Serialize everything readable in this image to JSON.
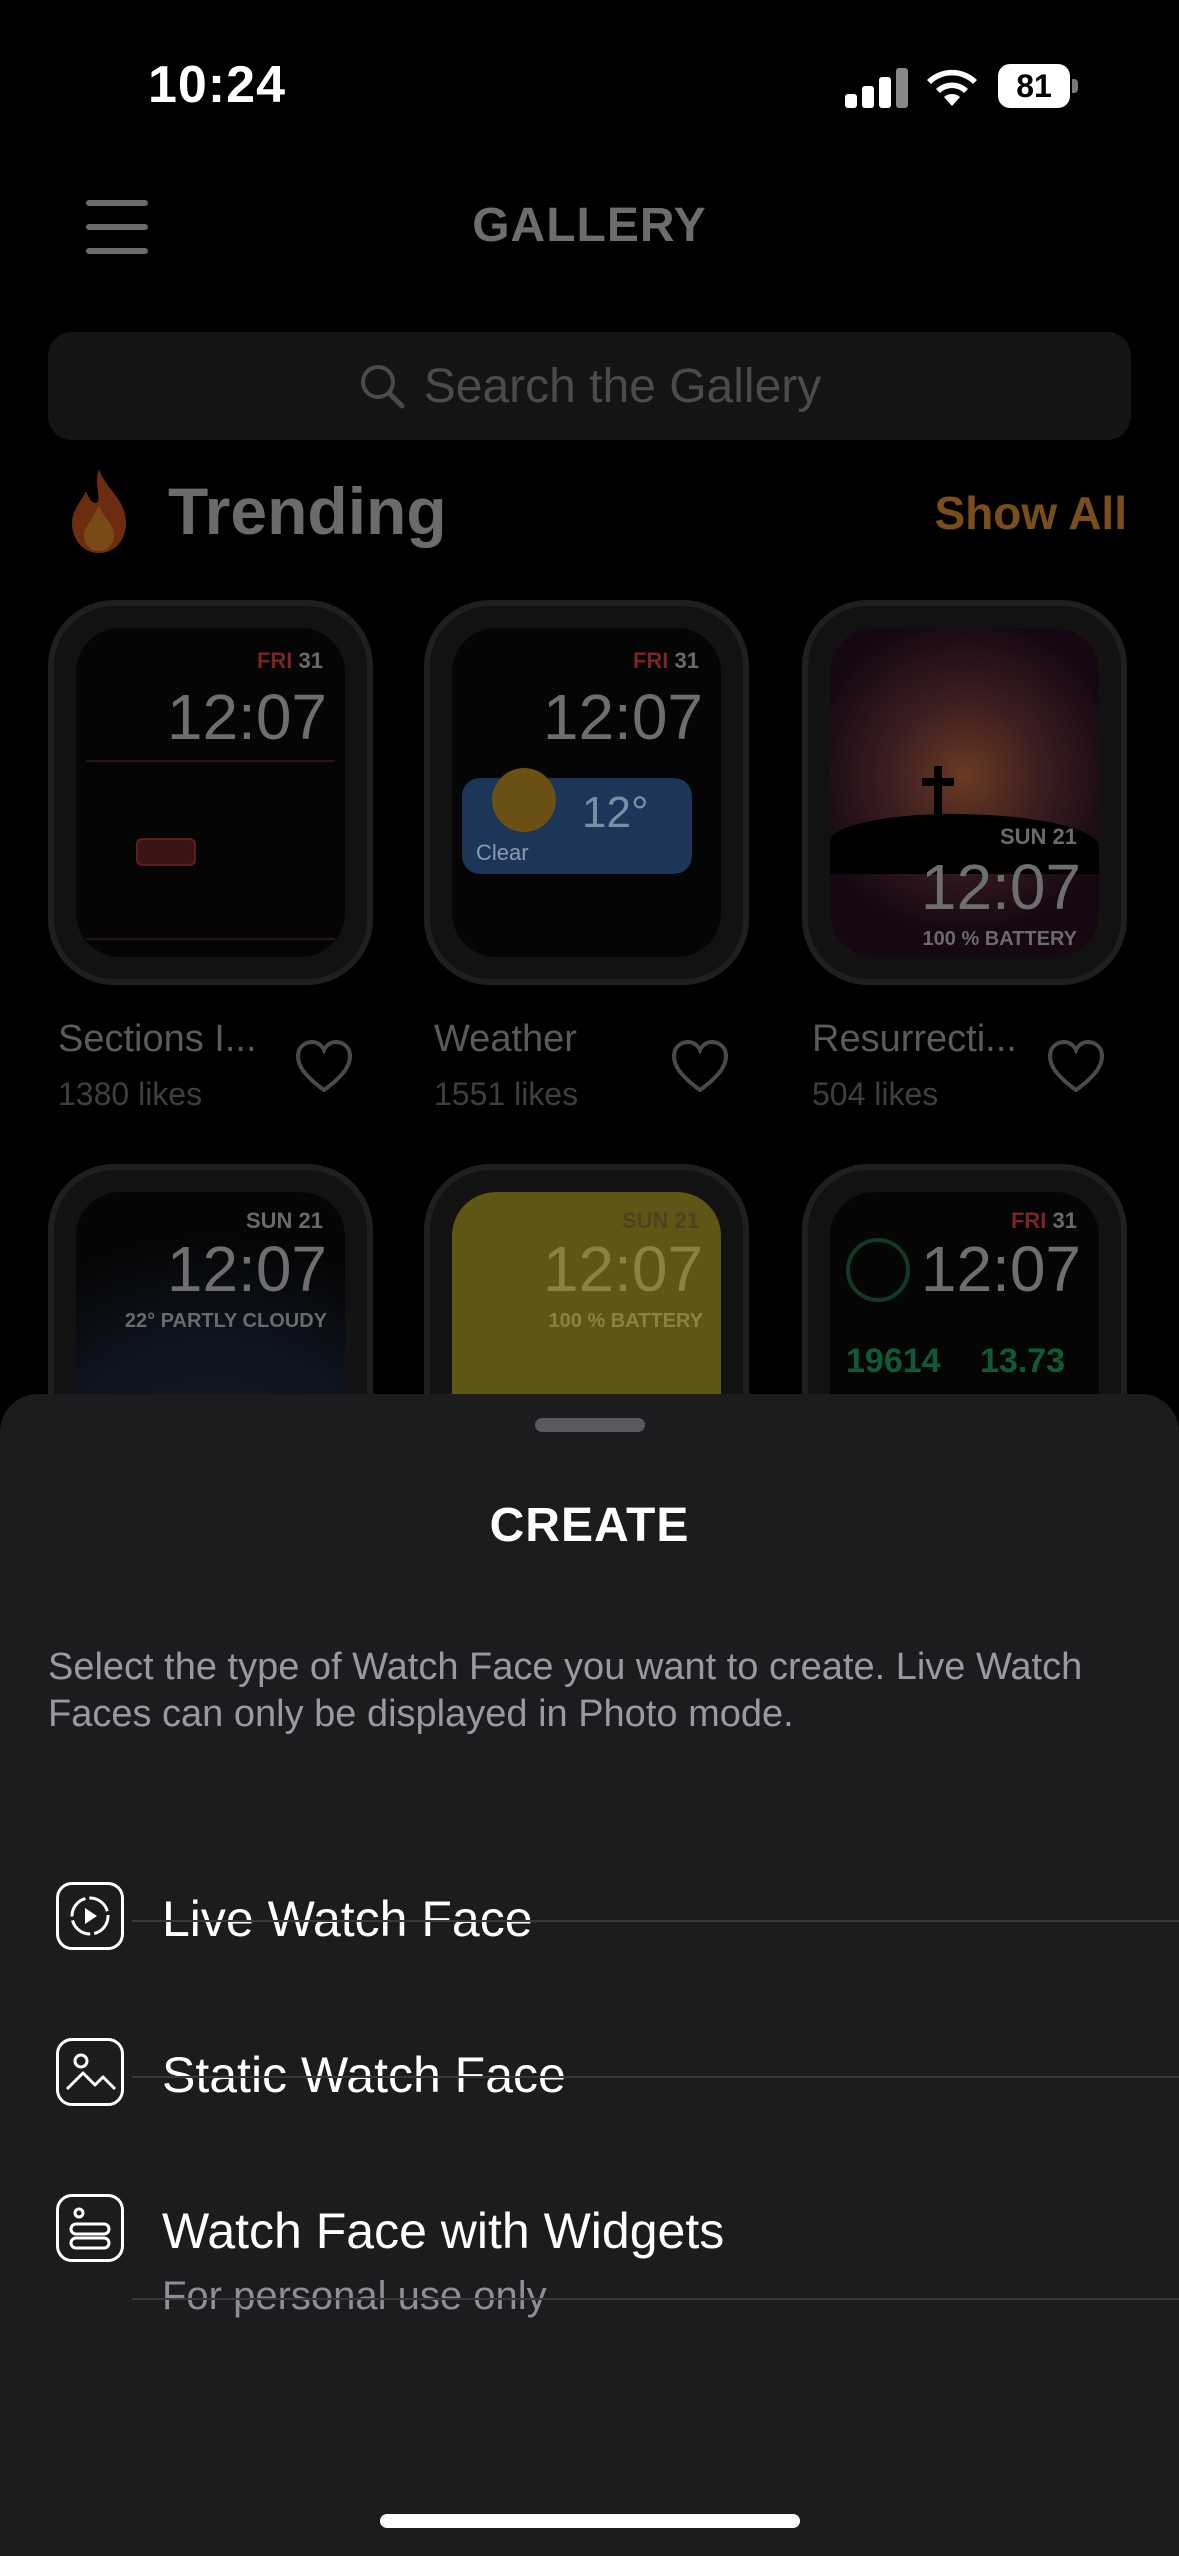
{
  "status_bar": {
    "time": "10:24",
    "battery": "81"
  },
  "header": {
    "title": "GALLERY"
  },
  "search": {
    "placeholder": "Search the Gallery"
  },
  "trending": {
    "label": "Trending",
    "show_all": "Show All",
    "cards": [
      {
        "title": "Sections I...",
        "likes": "1380 likes",
        "time": "12:07",
        "day": "FRI",
        "date": "31"
      },
      {
        "title": "Weather",
        "likes": "1551 likes",
        "time": "12:07",
        "day": "FRI",
        "date": "31",
        "temp": "12°",
        "condition": "Clear"
      },
      {
        "title": "Resurrecti...",
        "likes": "504 likes",
        "time": "12:07",
        "day": "SUN",
        "date": "21",
        "battery": "100 % BATTERY"
      },
      {
        "time": "12:07",
        "day": "SUN",
        "date": "21",
        "weather": "22° PARTLY CLOUDY"
      },
      {
        "time": "12:07",
        "day": "SUN",
        "date": "21",
        "battery": "100 % BATTERY"
      },
      {
        "time": "12:07",
        "day": "FRI",
        "date": "31",
        "steps": "19614",
        "km": "13.73"
      }
    ]
  },
  "sheet": {
    "title": "CREATE",
    "description": "Select the type of Watch Face you want to create. Live Watch Faces can only be displayed in Photo mode.",
    "options": [
      {
        "label": "Live Watch Face",
        "icon": "live-play-icon"
      },
      {
        "label": "Static Watch Face",
        "icon": "photo-icon"
      },
      {
        "label": "Watch Face with Widgets",
        "sublabel": "For personal use only",
        "icon": "widgets-icon"
      }
    ]
  }
}
